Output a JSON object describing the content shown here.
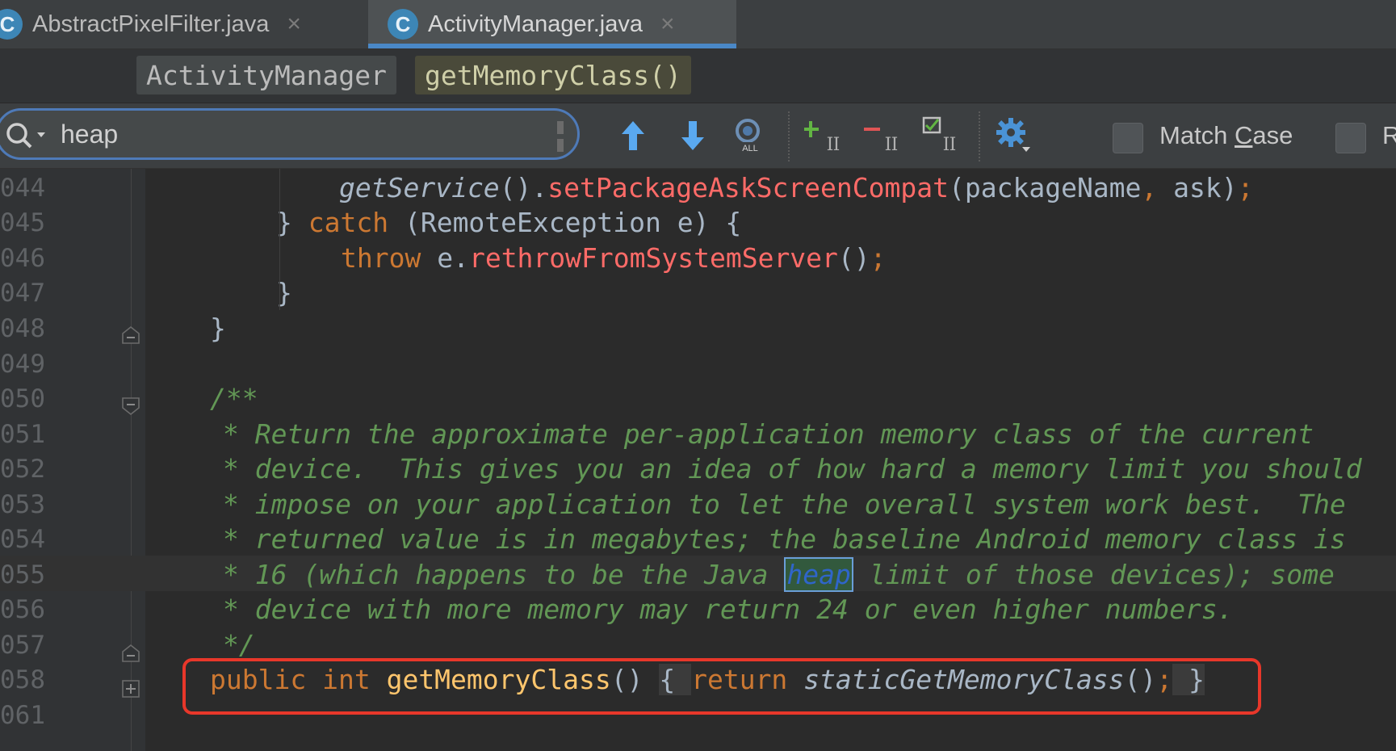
{
  "tabs": [
    {
      "icon": "C",
      "label": "AbstractPixelFilter.java",
      "active": false
    },
    {
      "icon": "C",
      "label": "ActivityManager.java",
      "active": true
    }
  ],
  "breadcrumb": {
    "class_name": "ActivityManager",
    "method_name": "getMemoryClass()"
  },
  "search": {
    "query": "heap",
    "match_case_label_pre": "Match ",
    "match_case_label_mnemonic": "C",
    "match_case_label_post": "ase",
    "next_option_label": "R"
  },
  "toolbar": {
    "icons": [
      "arrow-up-icon",
      "arrow-down-icon",
      "select-all-occurrences-icon",
      "add-cursor-icon",
      "remove-cursor-icon",
      "toggle-selection-icon",
      "settings-gear-icon"
    ]
  },
  "colors": {
    "keyword": "#cc7832",
    "method_call": "#ff6b68",
    "function_decl": "#ffc66d",
    "doc_comment": "#629755",
    "highlight_box": "#e8372a",
    "accent": "#4a88c7"
  },
  "editor": {
    "lines": [
      {
        "num": "044",
        "parts": [
          {
            "t": "getService",
            "c": "ital"
          },
          {
            "t": "()."
          },
          {
            "t": "setPackageAskScreenCompat",
            "c": "mcall"
          },
          {
            "t": "(packageName"
          },
          {
            "t": ",",
            "c": "kw"
          },
          {
            "t": " ask)"
          },
          {
            "t": ";",
            "c": "kw"
          }
        ]
      },
      {
        "num": "045",
        "parts": [
          {
            "t": "} "
          },
          {
            "t": "catch",
            "c": "kw"
          },
          {
            "t": " (RemoteException e) {"
          }
        ]
      },
      {
        "num": "046",
        "parts": [
          {
            "t": "throw",
            "c": "kw"
          },
          {
            "t": " e."
          },
          {
            "t": "rethrowFromSystemServer",
            "c": "mcall"
          },
          {
            "t": "()"
          },
          {
            "t": ";",
            "c": "kw"
          }
        ]
      },
      {
        "num": "047",
        "parts": [
          {
            "t": "}"
          }
        ]
      },
      {
        "num": "048",
        "parts": [
          {
            "t": "}"
          }
        ]
      },
      {
        "num": "049",
        "parts": []
      },
      {
        "num": "050",
        "parts": [
          {
            "t": "/**",
            "c": "doc"
          }
        ]
      },
      {
        "num": "051",
        "parts": [
          {
            "t": "* Return the approximate per-application memory class of the current",
            "c": "doc"
          }
        ]
      },
      {
        "num": "052",
        "parts": [
          {
            "t": "* device.  This gives you an idea of how hard a memory limit you should",
            "c": "doc"
          }
        ]
      },
      {
        "num": "053",
        "parts": [
          {
            "t": "* impose on your application to let the overall system work best.  The",
            "c": "doc"
          }
        ]
      },
      {
        "num": "054",
        "parts": [
          {
            "t": "* returned value is in megabytes; the baseline Android memory class is",
            "c": "doc"
          }
        ]
      },
      {
        "num": "055",
        "parts": [
          {
            "t": "* 16 (which happens to be the Java ",
            "c": "doc"
          },
          {
            "t": "heap",
            "c": "doc hl"
          },
          {
            "t": " limit of those devices); some",
            "c": "doc"
          }
        ]
      },
      {
        "num": "056",
        "parts": [
          {
            "t": "* device with more memory may return 24 or even higher numbers.",
            "c": "doc"
          }
        ]
      },
      {
        "num": "057",
        "parts": [
          {
            "t": "*/",
            "c": "doc"
          }
        ]
      },
      {
        "num": "058",
        "parts": [
          {
            "t": "public",
            "c": "kw"
          },
          {
            "t": " "
          },
          {
            "t": "int",
            "c": "kw"
          },
          {
            "t": " "
          },
          {
            "t": "getMemoryClass",
            "c": "fn"
          },
          {
            "t": "() "
          },
          {
            "t": "{ ",
            "c": "bracebg"
          },
          {
            "t": "return",
            "c": "kw"
          },
          {
            "t": " "
          },
          {
            "t": "staticGetMemoryClass",
            "c": "ital"
          },
          {
            "t": "()"
          },
          {
            "t": ";",
            "c": "kw"
          },
          {
            "t": " }",
            "c": "bracebg"
          }
        ]
      },
      {
        "num": "061",
        "parts": []
      }
    ]
  }
}
